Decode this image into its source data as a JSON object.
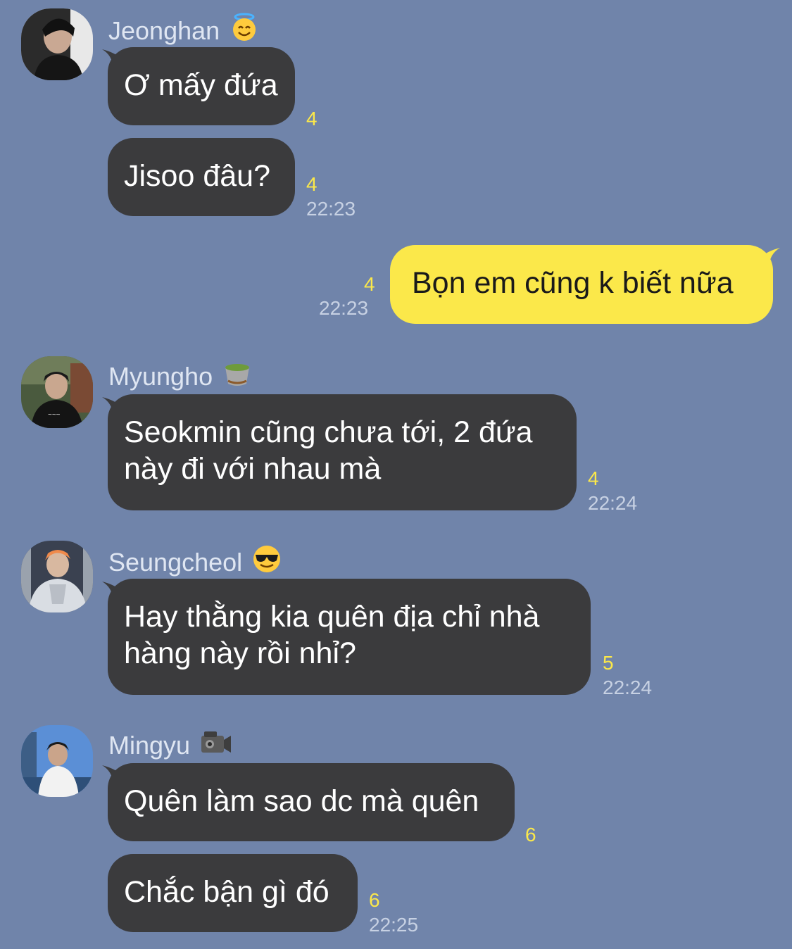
{
  "messages": [
    {
      "sender": "Jeonghan",
      "emoji": "halo-emoji",
      "bubbles": [
        {
          "text": "Ơ mấy đứa",
          "unread": "4"
        },
        {
          "text": "Jisoo đâu?",
          "unread": "4",
          "time": "22:23"
        }
      ]
    },
    {
      "sender": "me",
      "bubbles": [
        {
          "text": "Bọn em cũng k biết nữa",
          "unread": "4",
          "time": "22:23"
        }
      ]
    },
    {
      "sender": "Myungho",
      "emoji": "tea-emoji",
      "bubbles": [
        {
          "text": [
            "Seokmin cũng chưa tới, 2 đứa",
            "này đi với nhau mà"
          ],
          "unread": "4",
          "time": "22:24"
        }
      ]
    },
    {
      "sender": "Seungcheol",
      "emoji": "sunglasses-emoji",
      "bubbles": [
        {
          "text": [
            "Hay thằng kia quên địa chỉ nhà",
            "hàng này rồi nhỉ?"
          ],
          "unread": "5",
          "time": "22:24"
        }
      ]
    },
    {
      "sender": "Mingyu",
      "emoji": "video-camera-emoji",
      "bubbles": [
        {
          "text": "Quên làm sao dc mà quên",
          "unread": "6"
        },
        {
          "text": "Chắc bận gì đó",
          "unread": "6",
          "time": "22:25"
        }
      ]
    }
  ],
  "colors": {
    "background": "#7084aa",
    "other_bubble": "#3b3b3d",
    "my_bubble": "#fbe84a",
    "unread": "#fbe84a"
  }
}
